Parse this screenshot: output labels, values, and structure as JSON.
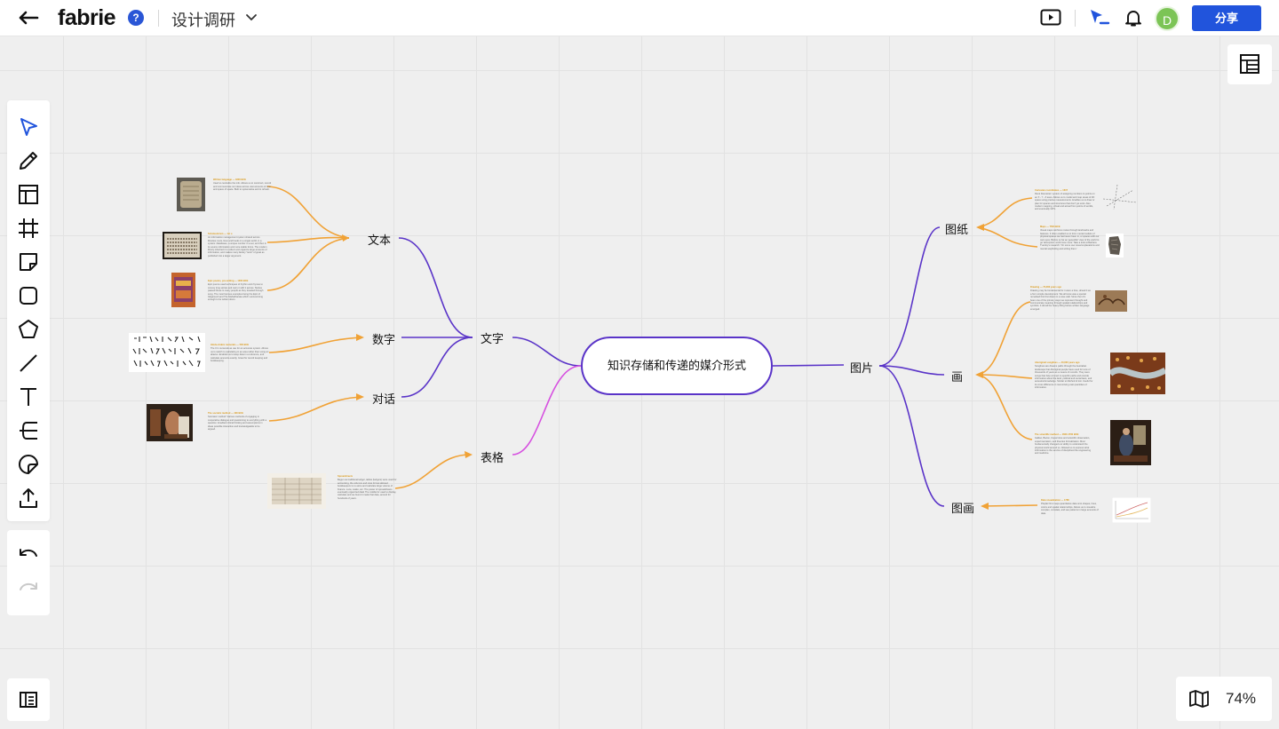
{
  "header": {
    "logo": "fabrie",
    "help_icon": "?",
    "doc_title": "设计调研",
    "avatar_initial": "D",
    "share_label": "分享"
  },
  "toolbar": {
    "tools": [
      "select-icon",
      "pen-icon",
      "frame-layout-icon",
      "grid-icon",
      "sticky-note-icon",
      "rectangle-icon",
      "polygon-icon",
      "line-icon",
      "text-icon",
      "mindmap-icon",
      "shape-icon",
      "upload-icon"
    ],
    "history": [
      "undo-icon",
      "redo-icon"
    ]
  },
  "zoom": {
    "level": "74%"
  },
  "mindmap": {
    "central": "知识存储和传递的媒介形式",
    "left": {
      "wenzi": "文字",
      "biaoge": "表格",
      "wenben": "文本",
      "shuzi": "数字",
      "duihua": "对话"
    },
    "right": {
      "tupian": "图片",
      "tuzhi": "图纸",
      "hua": "画",
      "tuhua": "图画"
    },
    "notes": {
      "n1": {
        "title": "Written language — 3200 BCE",
        "body": "Used to centralize the info. Allows us to construct, record and communicate our ideas across vast amounts of time and space of space. Built to systematise and to refresh."
      },
      "n2": {
        "title": "Scholasticism — 1st c.",
        "body": "An information management system shared across libraries; texts, lines and books in a single world, in a system: databases, a unique number in a set, and then in its source information and more stable forms. The modern library inherited it to collect and organize large amounts of information, and makes many literary \"texts\" of great as published into a larger argument."
      },
      "n3": {
        "title": "Epic poems, pre-writing — 1000 BCE",
        "body": "Epic poems used techniques of rhythm and rhymes to convey long stories and carry it with it across. Stories passed these to many people as they traveled through song. The most famous examples being the Epic of Gilgamesh and The Mahabharata which survived long enough to be written down."
      },
      "n4": {
        "title": "Hindu-Arabic numerals — 500 BCE",
        "body": "The 0 in numerals as use for an accurate system. Allows us to switch to calculating in an area rather than using an abacus. Enabled us to keep data in a reference, and calculate amounts exactly, Great for record keeping and bookkeeping."
      },
      "n5": {
        "title": "The socratic method — 400 BCE",
        "body": "Socrates' method: Various methods of engaging in cooperative dialogue and questioning to everything with a question. Enabled critical thinking and assumptions in ideas possible interactive and knowledgeable to be argued."
      },
      "n6": {
        "title": "Spreadsheets",
        "body": "Begun as traditional ledger, tables (ledgers) were used for accounting, the columns and rows format allowed bookkeepers to re-store and calculate large volume of finance. Luca, Laske, etc. The power of spreadsheets eventually organized data! The middle for used to display, calculate and we found it made that data, around for hundreds of years."
      },
      "n7": {
        "title": "Cartesian coordinates — 1637",
        "body": "René Descartes' system of assigning numbers to points on an X - Y - Z axes. Allows us to model and map areas of 2D space using precise measurements. Enables us to draw or plan for spaces and structures that don't yet exist. Also modern mapping, virtual and actual from points of worlds, and eventually GPS."
      },
      "n8": {
        "title": "Maps — 7500 BCE",
        "body": "Visual maps reinforce routes through landmarks and features. It often enabled us to form mental models of physical spaces we had never been in, or spaces with our own eyes. Before so far as 'geopolitic' view of the world to go 'absorption' world view more. Take a look at Barbara Tversky's research: 'On some use visual explanations and mental wayfinding and writing them.'"
      },
      "n9": {
        "title": "Drawing — 73,000 years ago",
        "body": "Drawing may be fundamental for it were a time, ahead it as a form simple development. We all know was a special remarked this first drawn in a cave wall. Since then it's been one of the primary ways we represent thought and communicate meaning through spatial relationships and symbols. It did all the heavy lifting before written language emerged."
      },
      "n10": {
        "title": "Aboriginal songlines — 40,000 years ago",
        "body": "Songlines are dreams paths through the Australian landscape that Aboriginal people have used for tens of thousands of years as a means of records. They were songs that help connect to specific paths and encode information about the land, political and social laws, and ancestral knowledge. Similar to Method of loci. Useful for its cross difference in memorising vast quantities of information."
      },
      "n11": {
        "title": "The scientific method — 1600-1700 BCE",
        "body": "Galileo, Bacon, Copernicus and scientific observation, experimentation, and theories formalization. Most fundamentally changed our ability to understand the physical world around us. Allowed us to express what information is the service of disciplined the engineering and medicine."
      },
      "n12": {
        "title": "Data visualization — 1786",
        "body": "Playfair first maps quantitative data onto shapes, lines, colors and spatial relationships. Allows us to visualize complex, correlate, and see patterns in large amounts of data."
      }
    }
  },
  "colors": {
    "accent": "#2154dc",
    "purple_branch": "#5a34c8",
    "pink_branch": "#d650e0",
    "orange_branch": "#f0a236",
    "grid": "#e2e2e2"
  }
}
